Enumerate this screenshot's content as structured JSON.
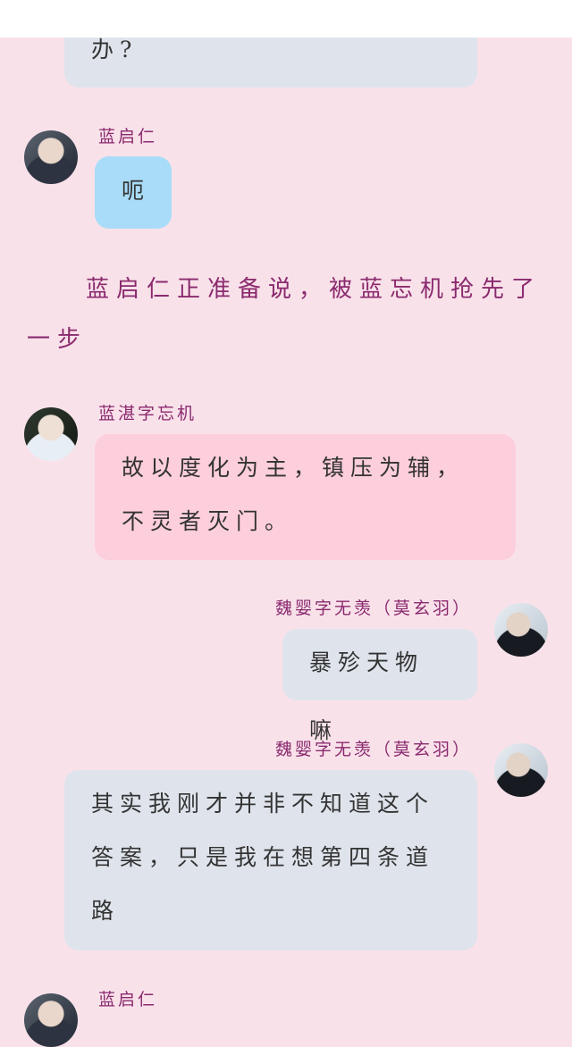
{
  "messages": [
    {
      "text": "办?"
    },
    {
      "sender": "蓝启仁",
      "text": "呃"
    },
    {
      "sender": "蓝湛字忘机",
      "line1": "故以度化为主，镇压为辅，",
      "line2": "不灵者灭门。"
    },
    {
      "sender": "魏婴字无羡（莫玄羽）",
      "text": "暴殄天物嘛"
    },
    {
      "sender": "魏婴字无羡（莫玄羽）",
      "line1": "其实我刚才并非不知道这个",
      "line2": "答案，只是我在想第四条道",
      "line3": "路"
    },
    {
      "sender": "蓝启仁"
    }
  ],
  "narration": "蓝启仁正准备说，被蓝忘机抢先了一步",
  "colors": {
    "background": "#f9e1ea",
    "name": "#8a2a6e",
    "gray_bubble": "#dfe4ec",
    "blue_bubble": "#a9dcf8",
    "pink_bubble": "#fdcedb"
  }
}
